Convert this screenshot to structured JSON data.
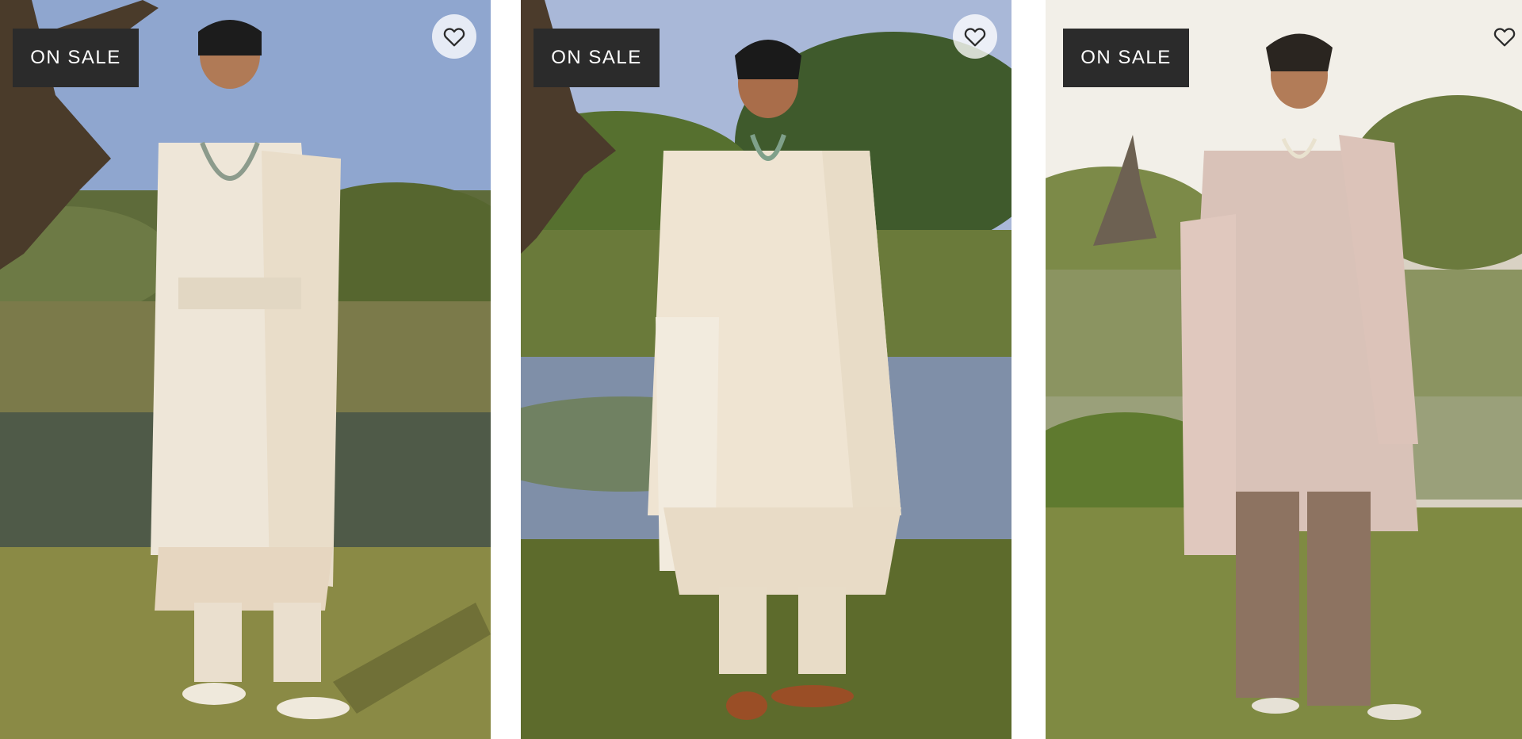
{
  "products": [
    {
      "badge": "ON SALE",
      "wishlist_icon": "heart-outline-icon",
      "image_alt": "Ivory embroidered sherwani with layered necklace and dupatta",
      "palette": {
        "sky": "#8fa6cf",
        "tree": "#5e6b3a",
        "water": "#4f5a48",
        "grass": "#8a8a45",
        "outfit": "#eee6d8"
      }
    },
    {
      "badge": "ON SALE",
      "wishlist_icon": "heart-outline-icon",
      "image_alt": "Cream embroidered sherwani with dupatta and tan shoes",
      "palette": {
        "sky": "#a9b8d8",
        "tree": "#3f5a2c",
        "water": "#7f8fa8",
        "grass": "#5d6b2c",
        "outfit": "#efe4d2"
      }
    },
    {
      "badge": "ON SALE",
      "wishlist_icon": "heart-outline-icon",
      "image_alt": "Blush pink embroidered sherwani with dupatta and trousers",
      "palette": {
        "sky": "#f2efe8",
        "tree": "#6b7a3d",
        "water": "#9aa07a",
        "grass": "#7f8a42",
        "outfit": "#d9c2b8"
      }
    }
  ]
}
